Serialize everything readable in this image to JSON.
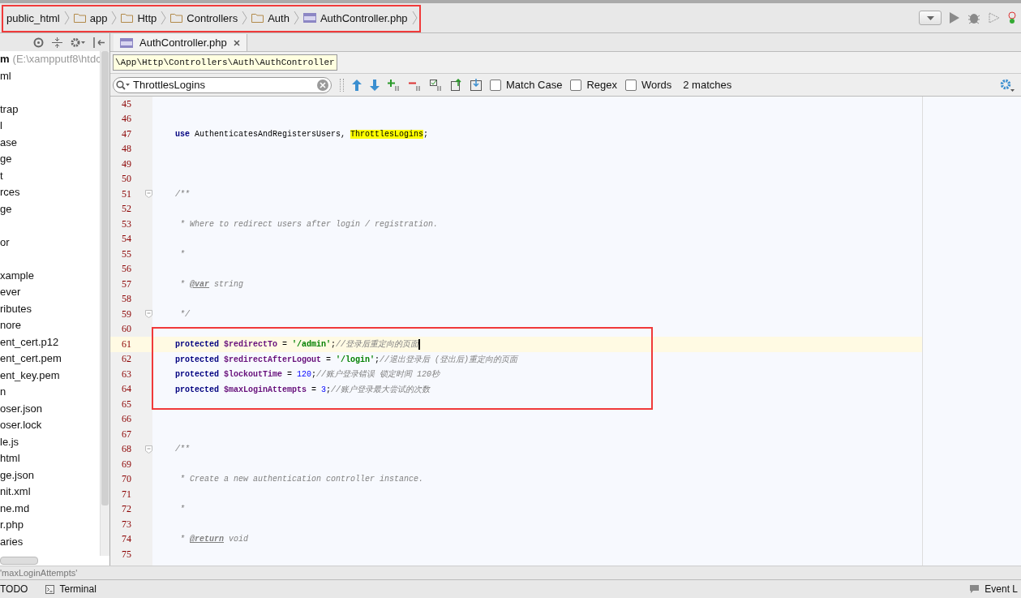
{
  "breadcrumbs": [
    {
      "label": "public_html",
      "kind": "root"
    },
    {
      "label": "app",
      "kind": "folder"
    },
    {
      "label": "Http",
      "kind": "folder"
    },
    {
      "label": "Controllers",
      "kind": "folder"
    },
    {
      "label": "Auth",
      "kind": "folder"
    },
    {
      "label": "AuthController.php",
      "kind": "php"
    }
  ],
  "project": {
    "root_name": "m",
    "root_path": "(E:\\xampputf8\\htdc",
    "items": [
      {
        "kind": "entry",
        "label": "ml"
      },
      {
        "kind": "blank"
      },
      {
        "kind": "entry",
        "label": "trap"
      },
      {
        "kind": "entry",
        "label": "l"
      },
      {
        "kind": "entry",
        "label": "ase"
      },
      {
        "kind": "entry",
        "label": "ge"
      },
      {
        "kind": "entry",
        "label": "t"
      },
      {
        "kind": "entry",
        "label": "rces"
      },
      {
        "kind": "entry",
        "label": "ge"
      },
      {
        "kind": "blank"
      },
      {
        "kind": "entry",
        "label": "or"
      },
      {
        "kind": "blank"
      },
      {
        "kind": "entry",
        "label": "xample"
      },
      {
        "kind": "entry",
        "label": "ever"
      },
      {
        "kind": "entry",
        "label": "ributes"
      },
      {
        "kind": "entry",
        "label": "nore"
      },
      {
        "kind": "entry",
        "label": "ent_cert.p12"
      },
      {
        "kind": "entry",
        "label": "ent_cert.pem"
      },
      {
        "kind": "entry",
        "label": "ent_key.pem"
      },
      {
        "kind": "entry",
        "label": "n"
      },
      {
        "kind": "entry",
        "label": "oser.json"
      },
      {
        "kind": "entry",
        "label": "oser.lock"
      },
      {
        "kind": "entry",
        "label": "le.js"
      },
      {
        "kind": "entry",
        "label": "html"
      },
      {
        "kind": "entry",
        "label": "ge.json"
      },
      {
        "kind": "entry",
        "label": "nit.xml"
      },
      {
        "kind": "entry",
        "label": "ne.md"
      },
      {
        "kind": "entry",
        "label": "r.php"
      },
      {
        "kind": "entry",
        "label": "aries"
      }
    ]
  },
  "tabs": [
    {
      "label": "AuthController.php",
      "selected": true
    }
  ],
  "tooltip": "\\App\\Http\\Controllers\\Auth\\AuthController",
  "search": {
    "value": "ThrottlesLogins",
    "options": [
      {
        "label": "Match Case",
        "checked": false
      },
      {
        "label": "Regex",
        "checked": false
      },
      {
        "label": "Words",
        "checked": false
      }
    ],
    "result": "2 matches"
  },
  "code": [
    {
      "number": "45"
    },
    {
      "number": "46"
    },
    {
      "number": "47",
      "tokens": [
        {
          "kind": "keyword",
          "text": "use"
        },
        {
          "kind": "plain",
          "text": " AuthenticatesAndRegistersUsers, "
        },
        {
          "kind": "match",
          "text": "ThrottlesLogins"
        },
        {
          "kind": "plain",
          "text": ";"
        }
      ]
    },
    {
      "number": "48"
    },
    {
      "number": "49"
    },
    {
      "number": "50"
    },
    {
      "number": "51",
      "fold": true,
      "tokens": [
        {
          "kind": "comment",
          "text": "/**"
        }
      ]
    },
    {
      "number": "52"
    },
    {
      "number": "53",
      "tokens": [
        {
          "kind": "comment",
          "text": " * Where to redirect users after login / registration."
        }
      ]
    },
    {
      "number": "54"
    },
    {
      "number": "55",
      "tokens": [
        {
          "kind": "comment",
          "text": " *"
        }
      ]
    },
    {
      "number": "56"
    },
    {
      "number": "57",
      "tokens": [
        {
          "kind": "comment",
          "text": " * "
        },
        {
          "kind": "doctag",
          "text": "@var"
        },
        {
          "kind": "comment",
          "text": " string"
        }
      ]
    },
    {
      "number": "58"
    },
    {
      "number": "59",
      "fold": true,
      "tokens": [
        {
          "kind": "comment",
          "text": " */"
        }
      ]
    },
    {
      "number": "60"
    },
    {
      "number": "61",
      "current": true,
      "tokens": [
        {
          "kind": "keyword",
          "text": "protected "
        },
        {
          "kind": "var",
          "text": "$redirectTo"
        },
        {
          "kind": "plain",
          "text": " = "
        },
        {
          "kind": "string",
          "text": "'/admin'"
        },
        {
          "kind": "plain",
          "text": ";"
        },
        {
          "kind": "comment",
          "text": "//登录后重定向的页面"
        }
      ]
    },
    {
      "number": "62",
      "tokens": [
        {
          "kind": "keyword",
          "text": "protected "
        },
        {
          "kind": "var",
          "text": "$redirectAfterLogout"
        },
        {
          "kind": "plain",
          "text": " = "
        },
        {
          "kind": "string",
          "text": "'/login'"
        },
        {
          "kind": "plain",
          "text": ";"
        },
        {
          "kind": "comment",
          "text": "//退出登录后 (登出后)重定向的页面"
        }
      ]
    },
    {
      "number": "63",
      "tokens": [
        {
          "kind": "keyword",
          "text": "protected "
        },
        {
          "kind": "var",
          "text": "$lockoutTime"
        },
        {
          "kind": "plain",
          "text": " = "
        },
        {
          "kind": "number",
          "text": "120"
        },
        {
          "kind": "plain",
          "text": ";"
        },
        {
          "kind": "comment",
          "text": "//账户登录错误 锁定时间 120秒"
        }
      ]
    },
    {
      "number": "64",
      "tokens": [
        {
          "kind": "keyword",
          "text": "protected "
        },
        {
          "kind": "var",
          "text": "$maxLoginAttempts"
        },
        {
          "kind": "plain",
          "text": " = "
        },
        {
          "kind": "number",
          "text": "3"
        },
        {
          "kind": "plain",
          "text": ";"
        },
        {
          "kind": "comment",
          "text": "//账户登录最大尝试的次数"
        }
      ]
    },
    {
      "number": "65"
    },
    {
      "number": "66"
    },
    {
      "number": "67"
    },
    {
      "number": "68",
      "fold": true,
      "tokens": [
        {
          "kind": "comment",
          "text": "/**"
        }
      ]
    },
    {
      "number": "69"
    },
    {
      "number": "70",
      "tokens": [
        {
          "kind": "comment",
          "text": " * Create a new authentication controller instance."
        }
      ]
    },
    {
      "number": "71"
    },
    {
      "number": "72",
      "tokens": [
        {
          "kind": "comment",
          "text": " *"
        }
      ]
    },
    {
      "number": "73"
    },
    {
      "number": "74",
      "tokens": [
        {
          "kind": "comment",
          "text": " * "
        },
        {
          "kind": "doctag",
          "text": "@return"
        },
        {
          "kind": "comment",
          "text": " void"
        }
      ]
    },
    {
      "number": "75"
    }
  ],
  "status": "'maxLoginAttempts'",
  "tool_windows": [
    {
      "label": "TODO",
      "kind": "plain"
    },
    {
      "label": "Terminal",
      "kind": "terminal"
    }
  ],
  "event_log": "Event L"
}
